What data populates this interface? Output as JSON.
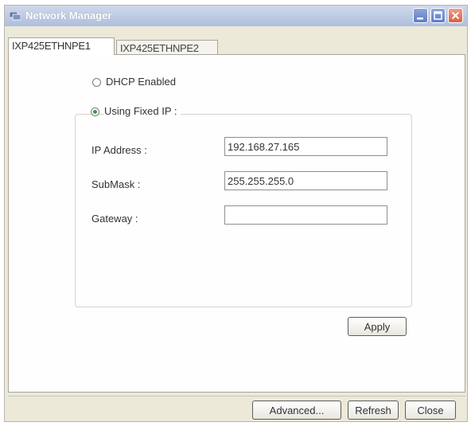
{
  "window": {
    "title": "Network Manager"
  },
  "tabs": [
    {
      "label": "IXP425ETHNPE1",
      "active": true
    },
    {
      "label": "IXP425ETHNPE2",
      "active": false
    }
  ],
  "ip_mode": {
    "dhcp_label": "DHCP Enabled",
    "fixed_label": "Using Fixed IP :",
    "selected": "fixed"
  },
  "fields": {
    "ip_address": {
      "label": "IP Address :",
      "value": "192.168.27.165"
    },
    "submask": {
      "label": "SubMask :",
      "value": "255.255.255.0"
    },
    "gateway": {
      "label": "Gateway :",
      "value": ""
    }
  },
  "buttons": {
    "apply": "Apply",
    "advanced": "Advanced...",
    "refresh": "Refresh",
    "close": "Close"
  },
  "icons": {
    "app": "network-icon",
    "minimize": "minimize-icon",
    "maximize": "maximize-icon",
    "close": "close-icon"
  },
  "colors": {
    "title_bar": "#aebfdd",
    "close_button": "#d9603f",
    "radio_selected": "#3b9a3b",
    "dialog_background": "#ece9d8"
  }
}
